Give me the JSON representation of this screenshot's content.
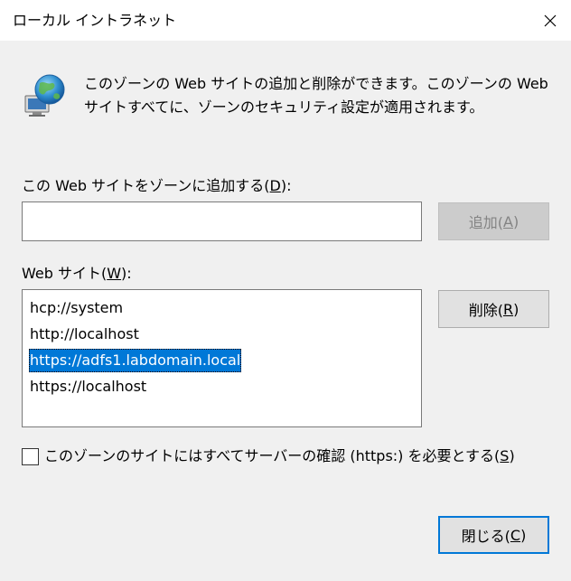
{
  "window": {
    "title": "ローカル イントラネット"
  },
  "intro": {
    "icon": "globe-computer-icon",
    "text": "このゾーンの Web サイトの追加と削除ができます。このゾーンの Web サイトすべてに、ゾーンのセキュリティ設定が適用されます。"
  },
  "add_site": {
    "label_prefix": "この Web サイトをゾーンに追加する(",
    "label_mnemonic": "D",
    "label_suffix": "):",
    "input_value": "",
    "button_prefix": "追加(",
    "button_mnemonic": "A",
    "button_suffix": ")"
  },
  "websites": {
    "label_prefix": "Web サイト(",
    "label_mnemonic": "W",
    "label_suffix": "):",
    "items": [
      "hcp://system",
      "http://localhost",
      "https://adfs1.labdomain.local",
      "https://localhost"
    ],
    "selected_index": 2,
    "remove_prefix": "削除(",
    "remove_mnemonic": "R",
    "remove_suffix": ")"
  },
  "require_https": {
    "label_prefix": "このゾーンのサイトにはすべてサーバーの確認 (https:) を必要とする(",
    "label_mnemonic": "S",
    "label_suffix": ")",
    "checked": false
  },
  "footer": {
    "close_prefix": "閉じる(",
    "close_mnemonic": "C",
    "close_suffix": ")"
  },
  "colors": {
    "accent": "#0078d7",
    "dialog_bg": "#f0f0f0",
    "disabled_text": "#838383"
  }
}
